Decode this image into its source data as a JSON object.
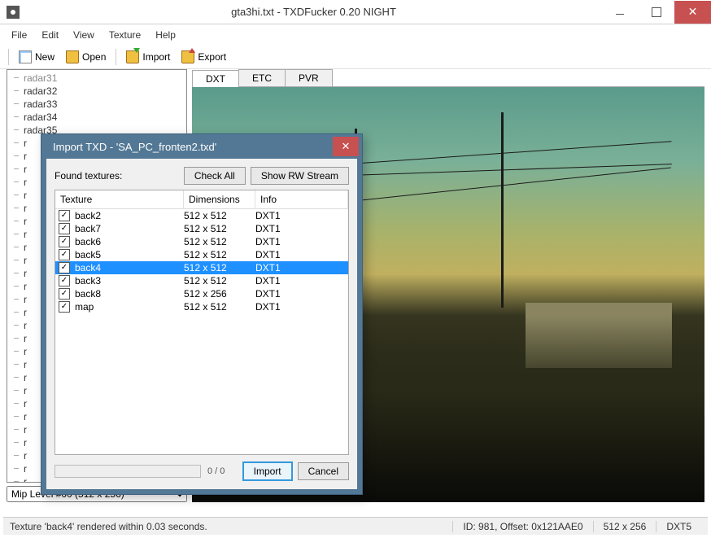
{
  "app": {
    "title": "gta3hi.txt - TXDFucker 0.20 NIGHT"
  },
  "menu": {
    "file": "File",
    "edit": "Edit",
    "view": "View",
    "texture": "Texture",
    "help": "Help"
  },
  "toolbar": {
    "new": "New",
    "open": "Open",
    "import": "Import",
    "export": "Export"
  },
  "tree": {
    "items": [
      "radar31",
      "radar32",
      "radar33",
      "radar34",
      "radar35",
      "r",
      "r",
      "r",
      "r",
      "r",
      "r",
      "r",
      "r",
      "r",
      "r",
      "r",
      "r",
      "r",
      "r",
      "r",
      "r",
      "r",
      "r",
      "r",
      "r",
      "r",
      "r",
      "r",
      "r",
      "r",
      "r",
      "r",
      "r"
    ],
    "selected": "radar31"
  },
  "mip": {
    "label": "Mip Level #00 (512 x 256)"
  },
  "tabs": {
    "dxt": "DXT",
    "etc": "ETC",
    "pvr": "PVR"
  },
  "status": {
    "left": "Texture 'back4' rendered within 0.03 seconds.",
    "id": "ID: 981, Offset: 0x121AAE0",
    "dim": "512 x 256",
    "fmt": "DXT5"
  },
  "modal": {
    "title": "Import TXD - 'SA_PC_fronten2.txd'",
    "found": "Found textures:",
    "check_all": "Check All",
    "show_rw": "Show RW Stream",
    "cols": {
      "c0": "Texture",
      "c1": "Dimensions",
      "c2": "Info"
    },
    "rows": [
      {
        "name": "back2",
        "dim": "512 x 512",
        "info": "DXT1",
        "sel": false
      },
      {
        "name": "back7",
        "dim": "512 x 512",
        "info": "DXT1",
        "sel": false
      },
      {
        "name": "back6",
        "dim": "512 x 512",
        "info": "DXT1",
        "sel": false
      },
      {
        "name": "back5",
        "dim": "512 x 512",
        "info": "DXT1",
        "sel": false
      },
      {
        "name": "back4",
        "dim": "512 x 512",
        "info": "DXT1",
        "sel": true
      },
      {
        "name": "back3",
        "dim": "512 x 512",
        "info": "DXT1",
        "sel": false
      },
      {
        "name": "back8",
        "dim": "512 x 256",
        "info": "DXT1",
        "sel": false
      },
      {
        "name": "map",
        "dim": "512 x 512",
        "info": "DXT1",
        "sel": false
      }
    ],
    "progress": "0 / 0",
    "import": "Import",
    "cancel": "Cancel"
  }
}
